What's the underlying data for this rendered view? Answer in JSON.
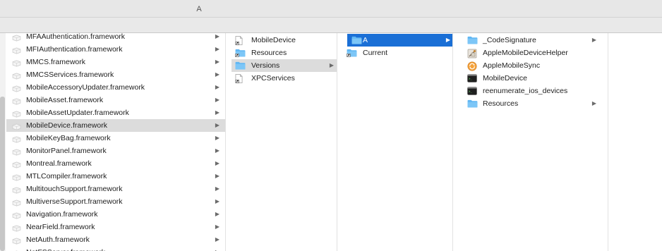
{
  "window": {
    "title": "A"
  },
  "columns": {
    "frameworks": [
      {
        "label": "MFAAuthentication.framework",
        "chevron": true
      },
      {
        "label": "MFIAuthentication.framework",
        "chevron": true
      },
      {
        "label": "MMCS.framework",
        "chevron": true
      },
      {
        "label": "MMCSServices.framework",
        "chevron": true
      },
      {
        "label": "MobileAccessoryUpdater.framework",
        "chevron": true
      },
      {
        "label": "MobileAsset.framework",
        "chevron": true
      },
      {
        "label": "MobileAssetUpdater.framework",
        "chevron": true
      },
      {
        "label": "MobileDevice.framework",
        "chevron": true,
        "selected": true
      },
      {
        "label": "MobileKeyBag.framework",
        "chevron": true
      },
      {
        "label": "MonitorPanel.framework",
        "chevron": true
      },
      {
        "label": "Montreal.framework",
        "chevron": true
      },
      {
        "label": "MTLCompiler.framework",
        "chevron": true
      },
      {
        "label": "MultitouchSupport.framework",
        "chevron": true
      },
      {
        "label": "MultiverseSupport.framework",
        "chevron": true
      },
      {
        "label": "Navigation.framework",
        "chevron": true
      },
      {
        "label": "NearField.framework",
        "chevron": true
      },
      {
        "label": "NetAuth.framework",
        "chevron": true
      },
      {
        "label": "NetFSServer.framework",
        "chevron": true
      }
    ],
    "mobiledevice": [
      {
        "label": "MobileDevice",
        "icon": "alias-document-icon"
      },
      {
        "label": "Resources",
        "icon": "alias-folder-icon"
      },
      {
        "label": "Versions",
        "icon": "folder-icon",
        "chevron": true,
        "selected": true
      },
      {
        "label": "XPCServices",
        "icon": "alias-document-icon"
      }
    ],
    "versions": [
      {
        "label": "A",
        "icon": "folder-icon",
        "chevron": true,
        "selected": true
      },
      {
        "label": "Current",
        "icon": "alias-folder-icon"
      }
    ],
    "a": [
      {
        "label": "_CodeSignature",
        "icon": "folder-icon",
        "chevron": true
      },
      {
        "label": "AppleMobileDeviceHelper",
        "icon": "app-helper-icon"
      },
      {
        "label": "AppleMobileSync",
        "icon": "sync-app-icon"
      },
      {
        "label": "MobileDevice",
        "icon": "executable-icon"
      },
      {
        "label": "reenumerate_ios_devices",
        "icon": "executable-icon"
      },
      {
        "label": "Resources",
        "icon": "folder-icon",
        "chevron": true
      }
    ]
  },
  "colors": {
    "selection_active": "#1a6fd6",
    "selection_inactive": "#dcdcdc",
    "folder": "#5fb6f3"
  }
}
